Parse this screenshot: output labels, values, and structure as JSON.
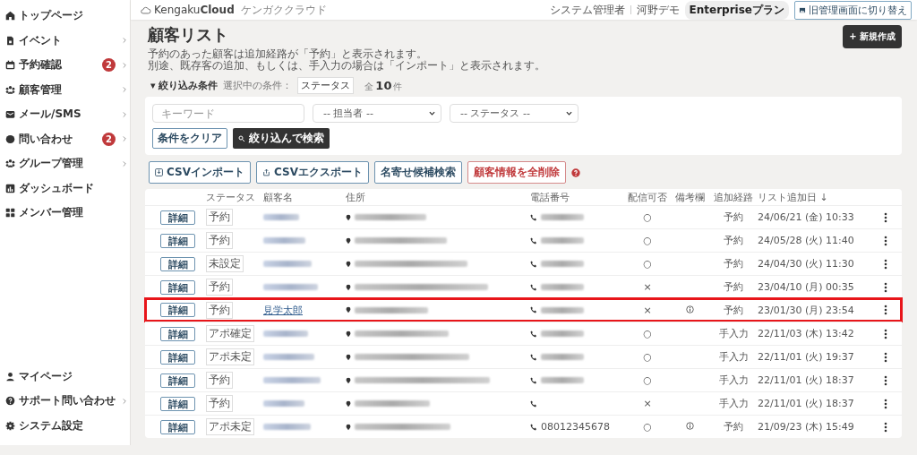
{
  "sidebar": {
    "items": [
      {
        "label": "トップページ",
        "submenu": false
      },
      {
        "label": "イベント",
        "submenu": true
      },
      {
        "label": "予約確認",
        "badge": "2",
        "submenu": true
      },
      {
        "label": "顧客管理",
        "submenu": true
      },
      {
        "label": "メール/SMS",
        "submenu": true
      },
      {
        "label": "問い合わせ",
        "badge": "2",
        "submenu": true
      },
      {
        "label": "グループ管理",
        "submenu": true
      },
      {
        "label": "ダッシュボード",
        "submenu": false
      },
      {
        "label": "メンバー管理",
        "submenu": false
      }
    ],
    "bottom_items": [
      {
        "label": "マイページ",
        "submenu": false
      },
      {
        "label": "サポート問い合わせ",
        "submenu": true
      },
      {
        "label": "システム設定",
        "submenu": false
      }
    ]
  },
  "header": {
    "logo_regular": "Kengaku",
    "logo_bold": "Cloud",
    "logo_sub": "ケンガククラウド",
    "role": "システム管理者",
    "user": "河野デモ",
    "plan": "Enterpriseプラン",
    "switch_button": "旧管理画面に切り替え"
  },
  "page": {
    "title": "顧客リスト",
    "new_button": "+ 新規作成",
    "description": [
      "予約のあった顧客は追加経路が「予約」と表示されます。",
      "別途、既存客の追加、もしくは、手入力の場合は「インポート」と表示されます。"
    ]
  },
  "filter": {
    "toggle": "▾ 絞り込み条件",
    "current_label": "選択中の条件：",
    "current_value": "ステータス",
    "total_prefix": "全",
    "total": "10",
    "total_suffix": "件",
    "keyword_placeholder": "キーワード",
    "staff_select": "-- 担当者 --",
    "status_select": "-- ステータス --",
    "clear_button": "条件をクリア",
    "search_button": "絞り込んで検索"
  },
  "actions": [
    {
      "label": "CSVインポート",
      "kind": "import"
    },
    {
      "label": "CSVエクスポート",
      "kind": "export"
    },
    {
      "label": "名寄せ候補検索",
      "kind": "plain"
    },
    {
      "label": "顧客情報を全削除",
      "kind": "danger"
    }
  ],
  "table": {
    "columns": [
      "ステータス",
      "顧客名",
      "住所",
      "電話番号",
      "配信可否",
      "備考欄",
      "追加経路",
      "リスト追加日 ↓"
    ],
    "rows": [
      {
        "detail": "詳細",
        "status": "予約",
        "name_redacted": true,
        "address_redacted": true,
        "phone_redacted": true,
        "opt_in": "○",
        "note": false,
        "source": "予約",
        "date": "24/06/21 (金) 10:33",
        "highlighted": false
      },
      {
        "detail": "詳細",
        "status": "予約",
        "name_redacted": true,
        "address_redacted": true,
        "phone_redacted": true,
        "opt_in": "○",
        "note": false,
        "source": "予約",
        "date": "24/05/28 (火) 11:40",
        "highlighted": false
      },
      {
        "detail": "詳細",
        "status": "未設定",
        "name_redacted": true,
        "address_redacted": true,
        "phone_redacted": true,
        "opt_in": "○",
        "note": false,
        "source": "予約",
        "date": "24/04/30 (火) 11:30",
        "highlighted": false
      },
      {
        "detail": "詳細",
        "status": "予約",
        "name_redacted": true,
        "address_redacted": true,
        "phone_redacted": true,
        "opt_in": "×",
        "note": false,
        "source": "予約",
        "date": "23/04/10 (月) 00:35",
        "highlighted": false
      },
      {
        "detail": "詳細",
        "status": "予約",
        "name": "見学太郎",
        "name_redacted": false,
        "address_redacted": true,
        "phone_redacted": true,
        "opt_in": "×",
        "note": true,
        "source": "予約",
        "date": "23/01/30 (月) 23:54",
        "highlighted": true
      },
      {
        "detail": "詳細",
        "status": "アポ確定",
        "name_redacted": true,
        "address_redacted": true,
        "phone_redacted": true,
        "opt_in": "○",
        "note": false,
        "source": "手入力",
        "date": "22/11/03 (木) 13:42",
        "highlighted": false
      },
      {
        "detail": "詳細",
        "status": "アポ未定",
        "name_redacted": true,
        "address_redacted": true,
        "phone_redacted": true,
        "opt_in": "○",
        "note": false,
        "source": "手入力",
        "date": "22/11/01 (火) 19:37",
        "highlighted": false
      },
      {
        "detail": "詳細",
        "status": "予約",
        "name_redacted": true,
        "address_redacted": true,
        "phone_redacted": true,
        "opt_in": "○",
        "note": false,
        "source": "手入力",
        "date": "22/11/01 (火) 18:37",
        "highlighted": false
      },
      {
        "detail": "詳細",
        "status": "予約",
        "name_redacted": true,
        "address_redacted": true,
        "phone_redacted": false,
        "opt_in": "×",
        "note": false,
        "source": "手入力",
        "date": "22/11/01 (火) 18:37",
        "highlighted": false
      },
      {
        "detail": "詳細",
        "status": "アポ未定",
        "name_redacted": true,
        "address_redacted": true,
        "phone": "08012345678",
        "phone_redacted": false,
        "opt_in": "○",
        "note": true,
        "source": "予約",
        "date": "21/09/23 (木) 15:49",
        "highlighted": false
      }
    ]
  }
}
